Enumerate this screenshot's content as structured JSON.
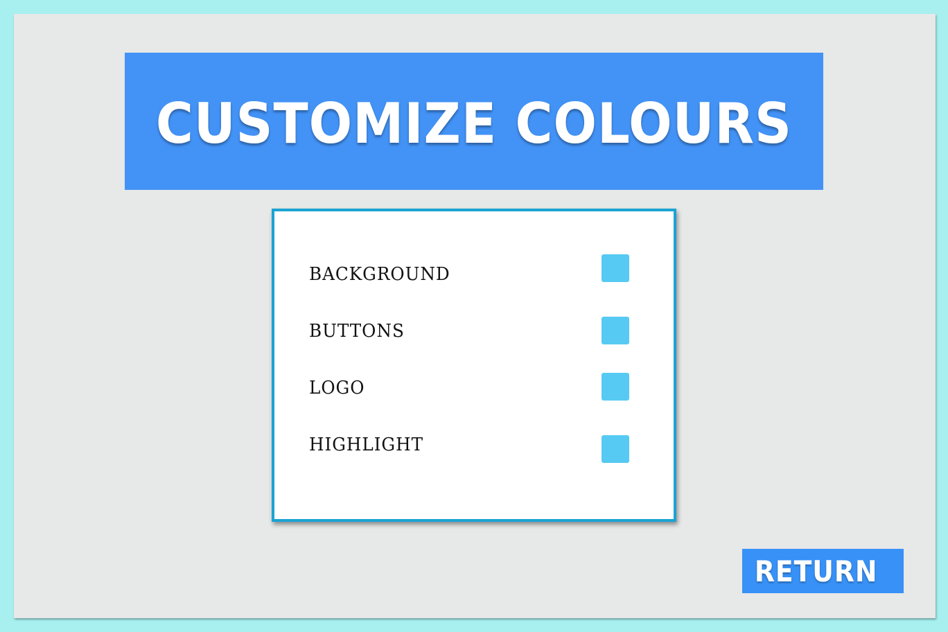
{
  "title": "CUSTOMIZE COLOURS",
  "colors": {
    "page_background": "#a8f0f0",
    "frame_background": "#e7e8e8",
    "banner": "#4393f7",
    "panel_border": "#1aa3d3",
    "return_button": "#3791f7"
  },
  "color_options": [
    {
      "label": "BACKGROUND",
      "swatch_color": "#56caf2"
    },
    {
      "label": "BUTTONS",
      "swatch_color": "#56caf2"
    },
    {
      "label": "LOGO",
      "swatch_color": "#56caf2"
    },
    {
      "label": "HIGHLIGHT",
      "swatch_color": "#56caf2"
    }
  ],
  "return_label": "RETURN"
}
